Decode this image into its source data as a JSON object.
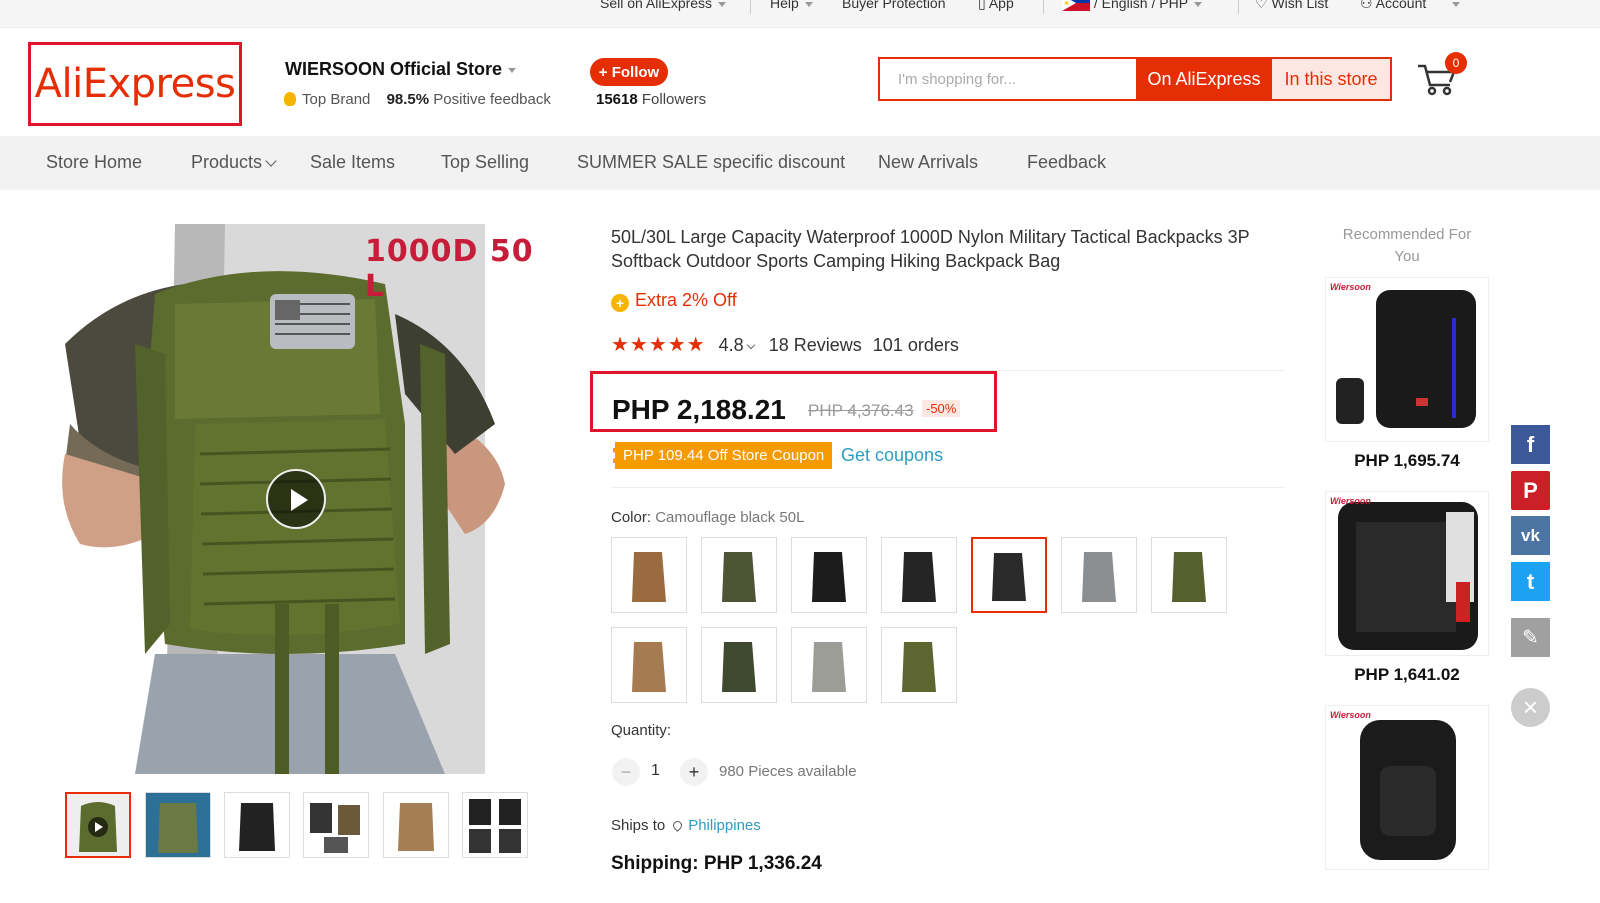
{
  "topbar": {
    "sell": "Sell on AliExpress",
    "help": "Help",
    "buyer_protection": "Buyer Protection",
    "app": "App",
    "language_currency": "/ English / PHP",
    "wish_list": "Wish List",
    "account": "Account"
  },
  "header": {
    "logo": "AliExpress",
    "store_name": "WIERSOON Official Store",
    "top_brand": "Top Brand",
    "feedback_pct": "98.5%",
    "feedback_label": "Positive feedback",
    "follow_label": "+ Follow",
    "followers_count": "15618",
    "followers_label": "Followers",
    "search_placeholder": "I'm shopping for...",
    "btn_on_ali": "On AliExpress",
    "btn_this_store": "In this store",
    "cart_count": "0"
  },
  "nav": {
    "items": [
      "Store Home",
      "Products",
      "Sale Items",
      "Top Selling",
      "SUMMER SALE specific discount",
      "New Arrivals",
      "Feedback"
    ]
  },
  "gallery": {
    "caption": "1000D  50 L"
  },
  "product": {
    "title": "50L/30L Large Capacity Waterproof 1000D Nylon Military Tactical Backpacks 3P Softback Outdoor Sports Camping Hiking Backpack Bag",
    "extra_off": "Extra 2% Off",
    "stars": "★★★★★",
    "rating": "4.8",
    "reviews": "18 Reviews",
    "orders": "101 orders",
    "price_now": "PHP 2,188.21",
    "price_old": "PHP 4,376.43",
    "discount": "-50%",
    "coupon": "PHP 109.44 Off Store Coupon",
    "get_coupons": "Get coupons",
    "color_label": "Color:",
    "color_value": "Camouflage black 50L",
    "quantity_label": "Quantity:",
    "quantity_value": "1",
    "qty_minus": "−",
    "qty_plus": "+",
    "available": "980 Pieces available",
    "ships_to_label": "Ships to",
    "ships_to_country": "Philippines",
    "shipping": "Shipping: PHP 1,336.24"
  },
  "recommended": {
    "title": "Recommended For You",
    "brand": "Wiersoon",
    "items": [
      {
        "price": "PHP 1,695.74"
      },
      {
        "price": "PHP 1,641.02"
      }
    ]
  },
  "social": {
    "facebook": "f",
    "pinterest": "P",
    "vk": "vk",
    "twitter": "t",
    "edit": "✎",
    "close": "×"
  },
  "colors": {
    "accent": "#e62e04",
    "highlight_box": "#e0142b",
    "link": "#2e9cc3",
    "coupon": "#f59b00",
    "olive": "#5c6b2e"
  }
}
